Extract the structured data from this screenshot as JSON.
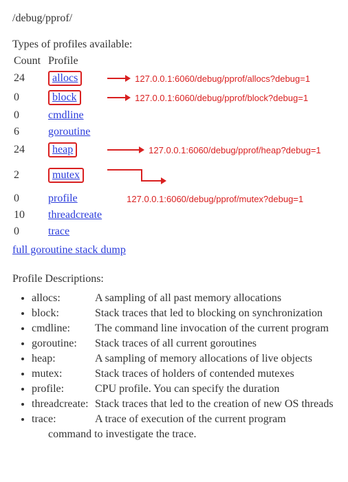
{
  "title": "/debug/pprof/",
  "types_header": "Types of profiles available:",
  "table": {
    "col_count": "Count",
    "col_profile": "Profile",
    "rows": [
      {
        "count": "24",
        "name": "allocs",
        "boxed": true,
        "arrow": "straight",
        "url": "127.0.0.1:6060/debug/pprof/allocs?debug=1"
      },
      {
        "count": "0",
        "name": "block",
        "boxed": true,
        "arrow": "straight",
        "url": "127.0.0.1:6060/debug/pprof/block?debug=1"
      },
      {
        "count": "0",
        "name": "cmdline",
        "boxed": false,
        "arrow": "",
        "url": ""
      },
      {
        "count": "6",
        "name": "goroutine",
        "boxed": false,
        "arrow": "",
        "url": ""
      },
      {
        "count": "24",
        "name": "heap",
        "boxed": true,
        "arrow": "straight",
        "url": "127.0.0.1:6060/debug/pprof/heap?debug=1"
      },
      {
        "count": "2",
        "name": "mutex",
        "boxed": true,
        "arrow": "down",
        "url": "127.0.0.1:6060/debug/pprof/mutex?debug=1"
      },
      {
        "count": "0",
        "name": "profile",
        "boxed": false,
        "arrow": "",
        "url": ""
      },
      {
        "count": "10",
        "name": "threadcreate",
        "boxed": false,
        "arrow": "",
        "url": ""
      },
      {
        "count": "0",
        "name": "trace",
        "boxed": false,
        "arrow": "",
        "url": ""
      }
    ]
  },
  "dump_link": "full goroutine stack dump",
  "desc_header": "Profile Descriptions:",
  "descriptions": [
    {
      "term": "allocs:",
      "text": "A sampling of all past memory allocations"
    },
    {
      "term": "block:",
      "text": "Stack traces that led to blocking on synchronization"
    },
    {
      "term": "cmdline:",
      "text": "The command line invocation of the current program"
    },
    {
      "term": "goroutine:",
      "text": "Stack traces of all current goroutines"
    },
    {
      "term": "heap:",
      "text": "A sampling of memory allocations of live objects"
    },
    {
      "term": "mutex:",
      "text": "Stack traces of holders of contended mutexes"
    },
    {
      "term": "profile:",
      "text": "CPU profile. You can specify the duration"
    },
    {
      "term": "threadcreate:",
      "text": "Stack traces that led to the creation of new OS threads"
    },
    {
      "term": "trace:",
      "text": "A trace of execution of the current program"
    }
  ],
  "trailing": "command to investigate the trace."
}
